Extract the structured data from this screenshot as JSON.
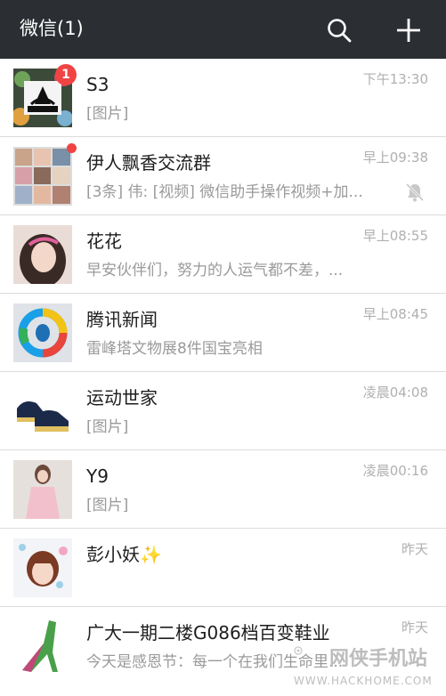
{
  "header": {
    "title": "微信(1)",
    "search_icon": "search-icon",
    "add_icon": "plus-icon",
    "bg": "#2b2e33"
  },
  "chats": [
    {
      "name": "S3",
      "preview": "[图片]",
      "time": "下午13:30",
      "badge": "1",
      "avatar_icon": "adidas-logo-avatar"
    },
    {
      "name": "伊人飘香交流群",
      "preview": "[3条] 伟: [视频] 微信助手操作视频+加...",
      "time": "早上09:38",
      "unread_dot": true,
      "muted": true,
      "avatar_icon": "group-grid-avatar"
    },
    {
      "name": "花花",
      "preview": "早安伙伴们，努力的人运气都不差，...",
      "time": "早上08:55",
      "avatar_icon": "girl-photo-avatar"
    },
    {
      "name": "腾讯新闻",
      "preview": "雷峰塔文物展8件国宝亮相",
      "time": "早上08:45",
      "avatar_icon": "tencent-news-logo"
    },
    {
      "name": "运动世家",
      "preview": "[图片]",
      "time": "凌晨04:08",
      "avatar_icon": "sneakers-avatar"
    },
    {
      "name": "Y9",
      "preview": "[图片]",
      "time": "凌晨00:16",
      "avatar_icon": "fashion-photo-avatar"
    },
    {
      "name": "彭小妖✨",
      "preview": "",
      "time": "昨天",
      "avatar_icon": "girl-portrait-avatar"
    },
    {
      "name": "广大一期二楼G086档百变鞋业",
      "preview": "今天是感恩节：每一个在我们生命里...",
      "time": "昨天",
      "avatar_icon": "high-heel-avatar"
    }
  ],
  "watermark": {
    "text": "网侠手机站",
    "url": "WWW.HACKHOME.COM"
  },
  "colors": {
    "badge": "#f04444",
    "time": "#b0b0b0",
    "preview": "#9a9a9a"
  }
}
